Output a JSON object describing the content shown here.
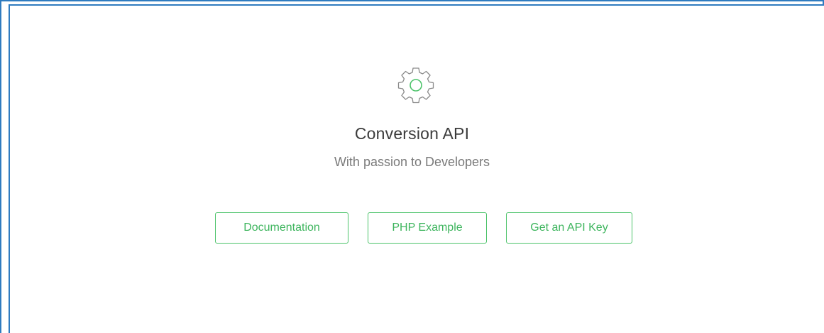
{
  "hero": {
    "icon": "gear-icon",
    "title": "Conversion API",
    "subtitle": "With passion to Developers"
  },
  "actions": {
    "documentation_label": "Documentation",
    "php_example_label": "PHP Example",
    "api_key_label": "Get an API Key"
  },
  "colors": {
    "accent": "#4cc36a",
    "frame": "#2f7bbf",
    "title": "#3b3b3b",
    "subtitle": "#7a7a7a",
    "gear_outline": "#8a8a8a"
  }
}
